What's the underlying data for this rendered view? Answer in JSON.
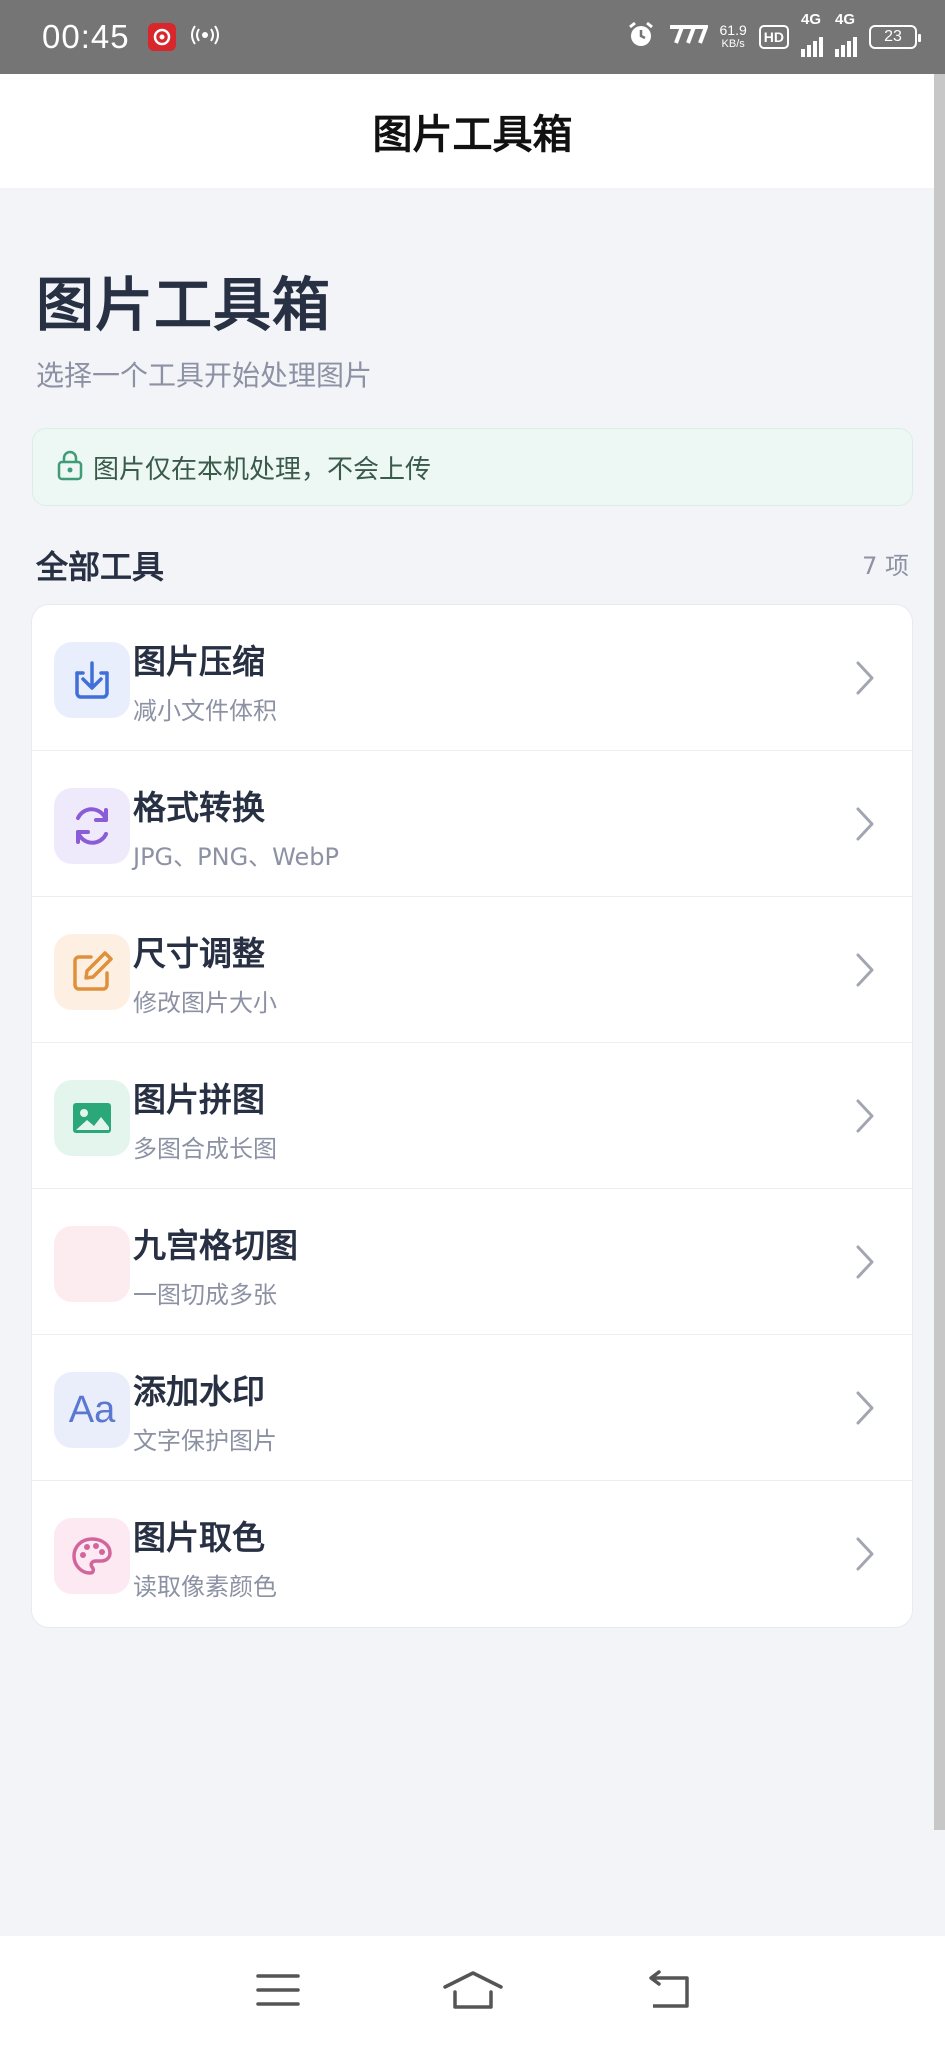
{
  "status_bar": {
    "time": "00:45",
    "net_speed_value": "61.9",
    "net_speed_unit": "KB/s",
    "hd_label": "HD",
    "sim1_label": "4G",
    "sim2_label": "4G",
    "battery_level": "23",
    "icons": [
      "notification-app-icon",
      "hotspot-icon",
      "alarm-icon",
      "network-speed-icon",
      "hd-icon",
      "signal-icon",
      "signal-icon",
      "battery-icon"
    ]
  },
  "header": {
    "title": "图片工具箱"
  },
  "hero": {
    "title": "图片工具箱",
    "subtitle": "选择一个工具开始处理图片"
  },
  "privacy": {
    "text": "图片仅在本机处理，不会上传",
    "icon": "lock-icon"
  },
  "section": {
    "title": "全部工具",
    "count": "7 项"
  },
  "tools": [
    {
      "title": "图片压缩",
      "desc": "减小文件体积",
      "icon": "download-icon",
      "color": "#3f6fd8",
      "bg": "#e9eefc"
    },
    {
      "title": "格式转换",
      "desc": "JPG、PNG、WebP",
      "icon": "refresh-icon",
      "color": "#8a5cd6",
      "bg": "#efeafb"
    },
    {
      "title": "尺寸调整",
      "desc": "修改图片大小",
      "icon": "edit-icon",
      "color": "#e0903a",
      "bg": "#fdf0e3"
    },
    {
      "title": "图片拼图",
      "desc": "多图合成长图",
      "icon": "image-icon",
      "color": "#2aa87a",
      "bg": "#e4f5ee"
    },
    {
      "title": "九宫格切图",
      "desc": "一图切成多张",
      "icon": "grid-icon",
      "color": "#e58aa0",
      "bg": "#fdecef"
    },
    {
      "title": "添加水印",
      "desc": "文字保护图片",
      "icon": "text-icon",
      "icon_text": "Aa",
      "color": "#5a78d2",
      "bg": "#eaeefb"
    },
    {
      "title": "图片取色",
      "desc": "读取像素颜色",
      "icon": "palette-icon",
      "color": "#d2669c",
      "bg": "#fce9f2"
    }
  ],
  "nav": {
    "icons": [
      "menu-icon",
      "home-icon",
      "back-icon"
    ]
  }
}
